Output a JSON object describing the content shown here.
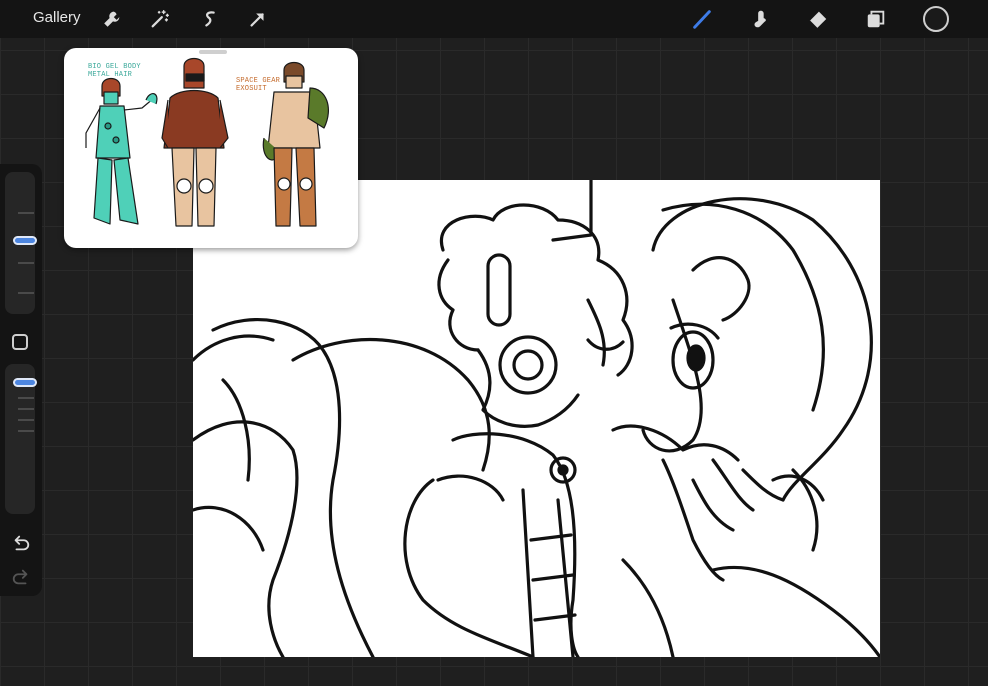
{
  "topbar": {
    "gallery_label": "Gallery",
    "left_tools": [
      "wrench-icon",
      "magic-wand-icon",
      "selection-icon",
      "transform-arrow-icon"
    ],
    "right_tools": [
      "brush-icon",
      "smudge-icon",
      "eraser-icon",
      "layers-icon",
      "color-swatch"
    ],
    "active_tool": "brush",
    "accent_color": "#3e7ce8",
    "current_color": "#1a1a1a"
  },
  "sidebar": {
    "size_slider_level": 0.5,
    "opacity_slider_level": 1.0,
    "buttons": [
      "modify-square-icon",
      "undo-icon",
      "redo-icon"
    ]
  },
  "reference": {
    "labels": {
      "robot": "BIO GEL BODY\nMETAL HAIR",
      "suit": "SPACE GEAR\nEXOSUIT"
    },
    "colors": {
      "robot_label": "#3aa89a",
      "suit_label": "#c46a2b"
    }
  }
}
